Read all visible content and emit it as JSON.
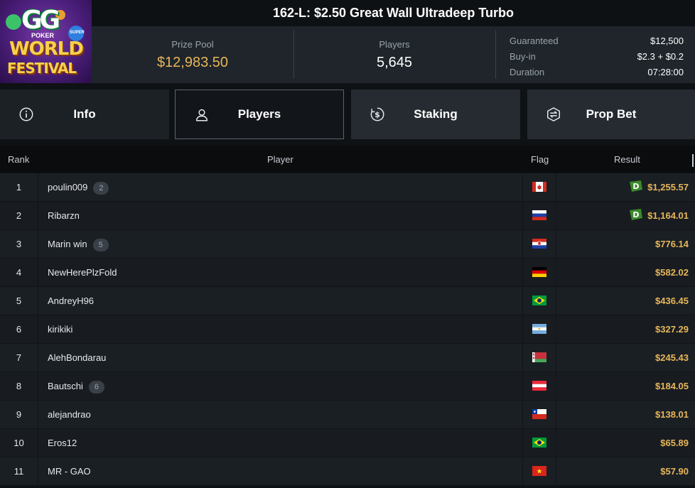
{
  "header": {
    "title": "162-L: $2.50 Great Wall Ultradeep Turbo",
    "logo": {
      "gg": "GG",
      "poker": "POKER",
      "super": "SUPER",
      "world": "WORLD",
      "festival": "FESTIVAL"
    },
    "prize_pool": {
      "label": "Prize Pool",
      "value": "$12,983.50"
    },
    "players": {
      "label": "Players",
      "value": "5,645"
    },
    "details": [
      {
        "label": "Guaranteed",
        "value": "$12,500"
      },
      {
        "label": "Buy-in",
        "value": "$2.3 + $0.2"
      },
      {
        "label": "Duration",
        "value": "07:28:00"
      }
    ]
  },
  "tabs": [
    {
      "label": "Info",
      "icon": "info-icon"
    },
    {
      "label": "Players",
      "icon": "user-icon",
      "active": true
    },
    {
      "label": "Staking",
      "icon": "dollar-coin-icon"
    },
    {
      "label": "Prop Bet",
      "icon": "prop-bet-icon"
    }
  ],
  "table": {
    "headers": {
      "rank": "Rank",
      "player": "Player",
      "flag": "Flag",
      "result": "Result"
    },
    "rows": [
      {
        "rank": "1",
        "player": "poulin009",
        "badge": "2",
        "flag": "canada",
        "result": "$1,255.57",
        "d_icon": true
      },
      {
        "rank": "2",
        "player": "Ribarzn",
        "badge": "",
        "flag": "russia",
        "result": "$1,164.01",
        "d_icon": true
      },
      {
        "rank": "3",
        "player": "Marin win",
        "badge": "5",
        "flag": "croatia",
        "result": "$776.14",
        "d_icon": false
      },
      {
        "rank": "4",
        "player": "NewHerePlzFold",
        "badge": "",
        "flag": "germany",
        "result": "$582.02",
        "d_icon": false
      },
      {
        "rank": "5",
        "player": "AndreyH96",
        "badge": "",
        "flag": "brazil",
        "result": "$436.45",
        "d_icon": false
      },
      {
        "rank": "6",
        "player": "kirikiki",
        "badge": "",
        "flag": "argentina",
        "result": "$327.29",
        "d_icon": false
      },
      {
        "rank": "7",
        "player": "AlehBondarau",
        "badge": "",
        "flag": "belarus",
        "result": "$245.43",
        "d_icon": false
      },
      {
        "rank": "8",
        "player": "Bautschi",
        "badge": "6",
        "flag": "austria",
        "result": "$184.05",
        "d_icon": false
      },
      {
        "rank": "9",
        "player": "alejandrao",
        "badge": "",
        "flag": "chile",
        "result": "$138.01",
        "d_icon": false
      },
      {
        "rank": "10",
        "player": "Eros12",
        "badge": "",
        "flag": "brazil",
        "result": "$65.89",
        "d_icon": false
      },
      {
        "rank": "11",
        "player": "MR - GAO",
        "badge": "",
        "flag": "vietnam",
        "result": "$57.90",
        "d_icon": false
      }
    ]
  },
  "colors": {
    "accent_gold": "#e7b659",
    "background": "#0f1215",
    "d_badge_green": "#3a8a2a"
  }
}
